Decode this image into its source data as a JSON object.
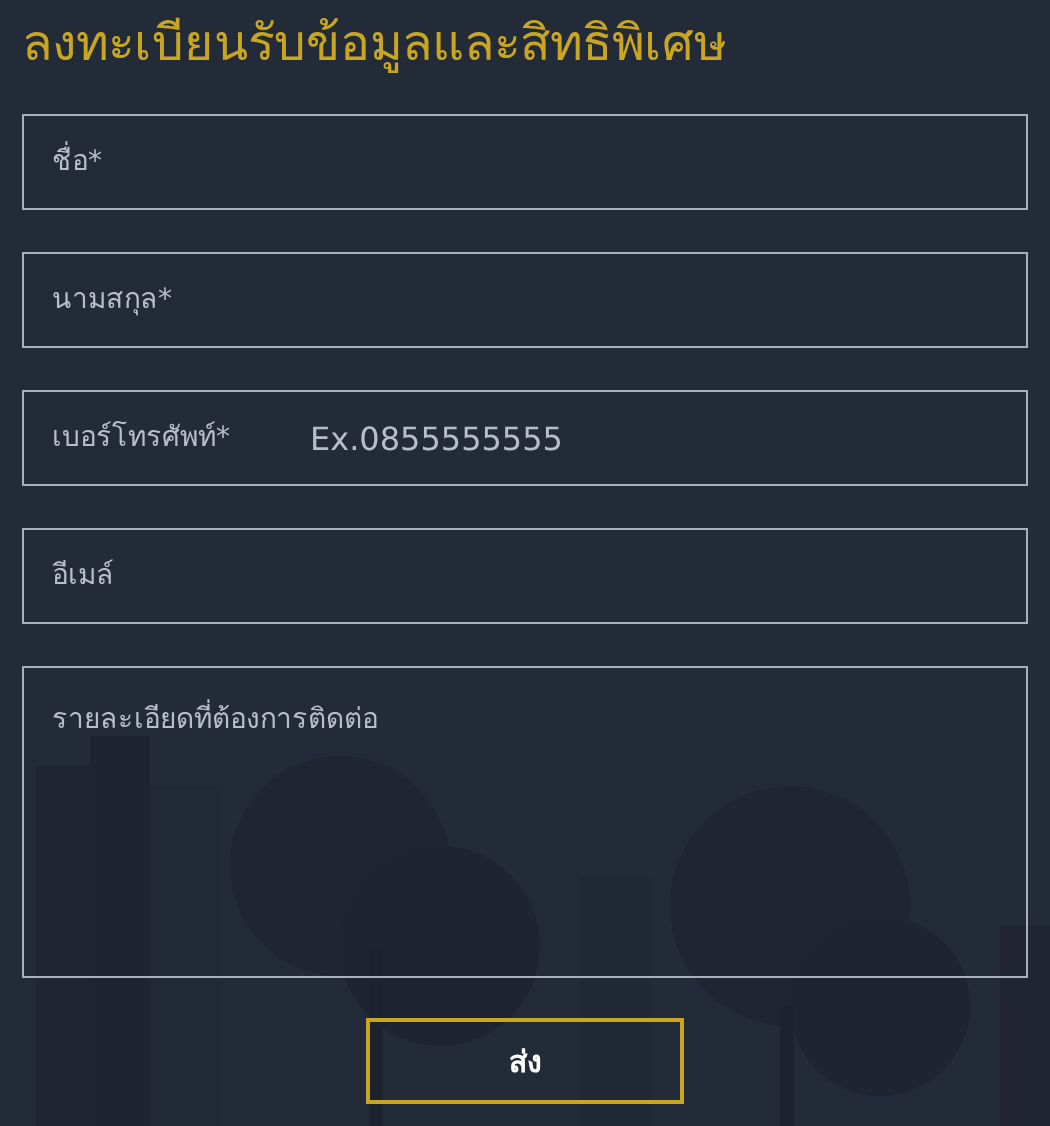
{
  "title": "ลงทะเบียนรับข้อมูลและสิทธิพิเศษ",
  "fields": [
    {
      "kind": "input",
      "placeholder": "ชื่อ*"
    },
    {
      "kind": "input",
      "placeholder": "นามสกุล*"
    },
    {
      "kind": "labeled",
      "label": "เบอร์โทรศัพท์*",
      "placeholder": "Ex.0855555555"
    },
    {
      "kind": "input",
      "placeholder": "อีเมล์"
    },
    {
      "kind": "textarea",
      "placeholder": "รายละเอียดที่ต้องการติดต่อ"
    }
  ],
  "submit": "ส่ง"
}
